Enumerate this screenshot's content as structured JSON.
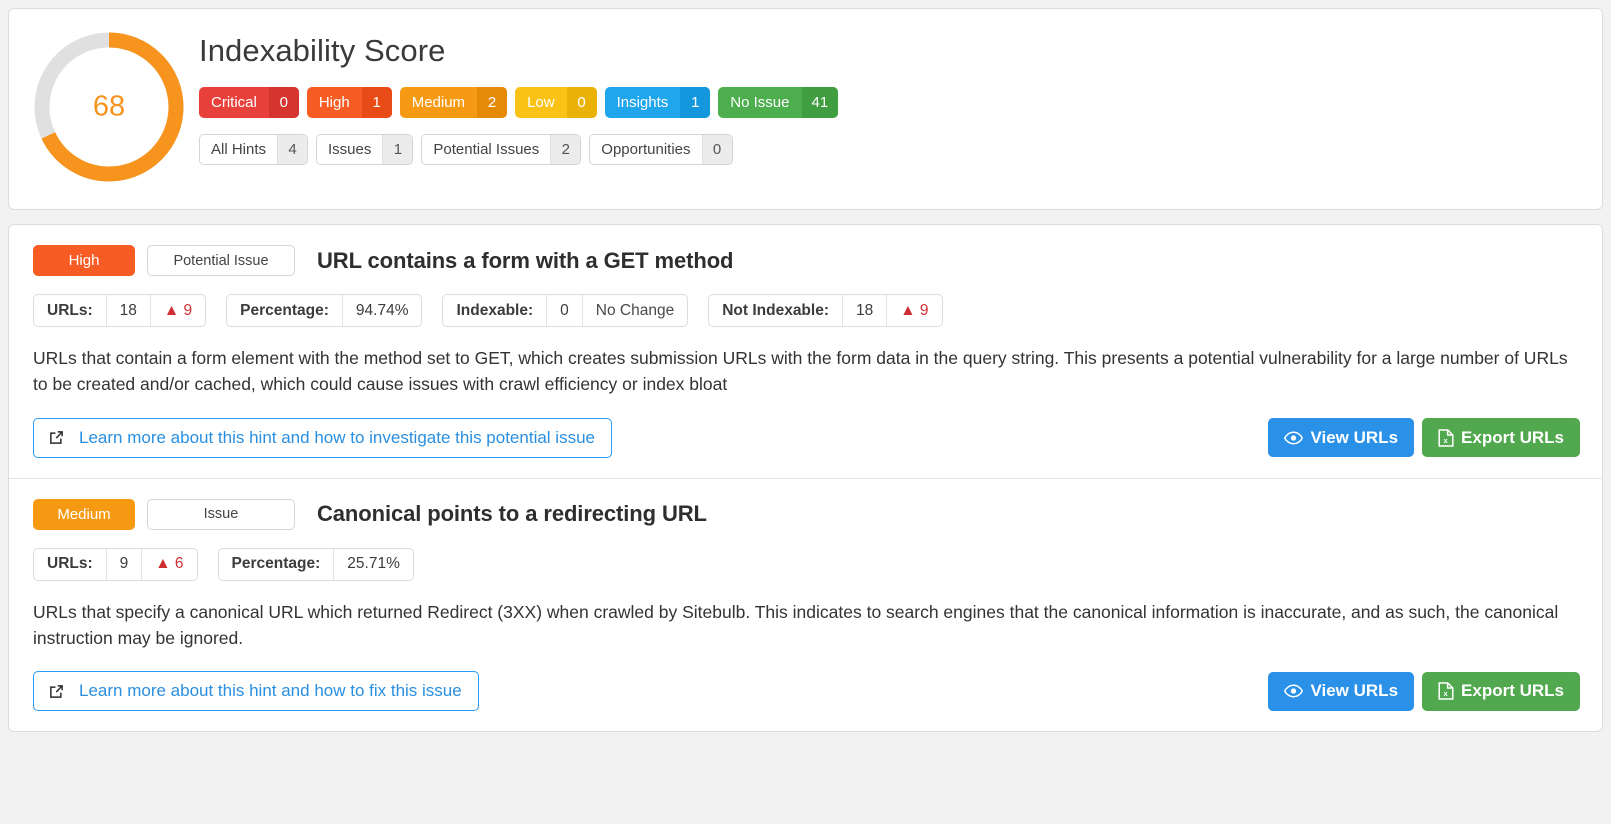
{
  "score_panel": {
    "title": "Indexability Score",
    "gauge": {
      "value": "68",
      "percent": 68,
      "arc_color": "#f7941d",
      "track_color": "#e0e0e0"
    },
    "badges": [
      {
        "label": "Critical",
        "count": "0",
        "color": "#e8413c",
        "count_color": "#d5342f"
      },
      {
        "label": "High",
        "count": "1",
        "color": "#f85c25",
        "count_color": "#e84b16"
      },
      {
        "label": "Medium",
        "count": "2",
        "color": "#f79a13",
        "count_color": "#e58a06"
      },
      {
        "label": "Low",
        "count": "0",
        "color": "#fac215",
        "count_color": "#eab207"
      },
      {
        "label": "Insights",
        "count": "1",
        "color": "#20a6ec",
        "count_color": "#1497dd"
      },
      {
        "label": "No Issue",
        "count": "41",
        "color": "#4cae4c",
        "count_color": "#409e40"
      }
    ],
    "pills": [
      {
        "label": "All Hints",
        "count": "4"
      },
      {
        "label": "Issues",
        "count": "1"
      },
      {
        "label": "Potential Issues",
        "count": "2"
      },
      {
        "label": "Opportunities",
        "count": "0"
      }
    ]
  },
  "hints": [
    {
      "severity": {
        "label": "High",
        "color": "#f85c25"
      },
      "type": "Potential Issue",
      "title": "URL contains a form with a GET method",
      "metrics": [
        {
          "key": "URLs:",
          "value": "18",
          "extra": "▲ 9",
          "extra_kind": "delta"
        },
        {
          "key": "Percentage:",
          "value": "94.74%",
          "extra": "",
          "extra_kind": "none"
        },
        {
          "key": "Indexable:",
          "value": "0",
          "extra": "No Change",
          "extra_kind": "nochange"
        },
        {
          "key": "Not Indexable:",
          "value": "18",
          "extra": "▲ 9",
          "extra_kind": "delta"
        }
      ],
      "description": "URLs that contain a form element with the method set to GET, which creates submission URLs with the form data in the query string. This presents a potential vulnerability for a large number of URLs to be created and/or cached, which could cause issues with crawl efficiency or index bloat",
      "learn_more": "Learn more about this hint and how to investigate this potential issue",
      "view_button": "View URLs",
      "export_button": "Export URLs"
    },
    {
      "severity": {
        "label": "Medium",
        "color": "#f79a13"
      },
      "type": "Issue",
      "title": "Canonical points to a redirecting URL",
      "metrics": [
        {
          "key": "URLs:",
          "value": "9",
          "extra": "▲ 6",
          "extra_kind": "delta"
        },
        {
          "key": "Percentage:",
          "value": "25.71%",
          "extra": "",
          "extra_kind": "none"
        }
      ],
      "description": "URLs that specify a canonical URL which returned Redirect (3XX) when crawled by Sitebulb. This indicates to search engines that the canonical information is inaccurate, and as such, the canonical instruction may be ignored.",
      "learn_more": "Learn more about this hint and how to fix this issue",
      "view_button": "View URLs",
      "export_button": "Export URLs"
    }
  ]
}
